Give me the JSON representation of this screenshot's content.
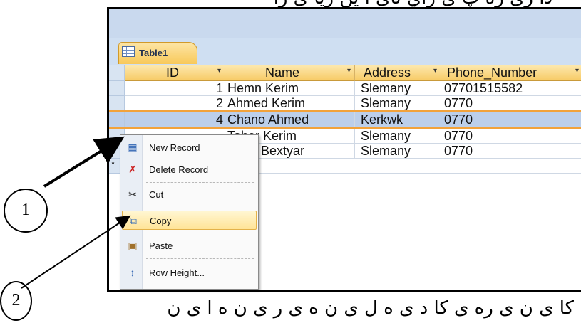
{
  "top_arabic_text": "ذا زی ره پ ى زاي نای ا ین زیا ی زا ",
  "bottom_arabic_text": "کا ی ن ی ره ى کا د ی ه ل ی ن ه ی ر ی ن ه ا ی ن",
  "tab": {
    "label": "Table1",
    "icon": "table-icon"
  },
  "columns": [
    {
      "label": "ID",
      "dropdown": "▾"
    },
    {
      "label": "Name",
      "dropdown": "▾"
    },
    {
      "label": "Address",
      "dropdown": "▾"
    },
    {
      "label": "Phone_Number",
      "dropdown": "▾"
    }
  ],
  "rows": [
    {
      "id": "1",
      "name": "Hemn Kerim",
      "address": "Slemany",
      "phone": "07701515582"
    },
    {
      "id": "2",
      "name": "Ahmed Kerim",
      "address": "Slemany",
      "phone": "0770"
    },
    {
      "id": "4",
      "name": "Chano Ahmed",
      "address": "Kerkwk",
      "phone": "0770"
    },
    {
      "id": "",
      "name": "Taher Kerim",
      "address": "Slemany",
      "phone": "0770"
    },
    {
      "id": "",
      "name": "Nevo Bextyar",
      "address": "Slemany",
      "phone": "0770"
    }
  ],
  "new_row_marker": "*",
  "context_menu": [
    {
      "label": "New Record",
      "icon": "new-record-icon"
    },
    {
      "label": "Delete Record",
      "icon": "delete-record-icon"
    },
    {
      "label": "Cut",
      "icon": "scissors-icon"
    },
    {
      "label": "Copy",
      "icon": "copy-icon",
      "highlighted": true
    },
    {
      "label": "Paste",
      "icon": "paste-icon"
    },
    {
      "label": "Row Height...",
      "icon": "row-height-icon"
    }
  ],
  "callouts": [
    "1",
    "2"
  ],
  "colors": {
    "header": "#f7cb66",
    "selected_row": "#bccfea",
    "menu_highlight": "#ffe497",
    "accent_line": "#f2a23a"
  }
}
